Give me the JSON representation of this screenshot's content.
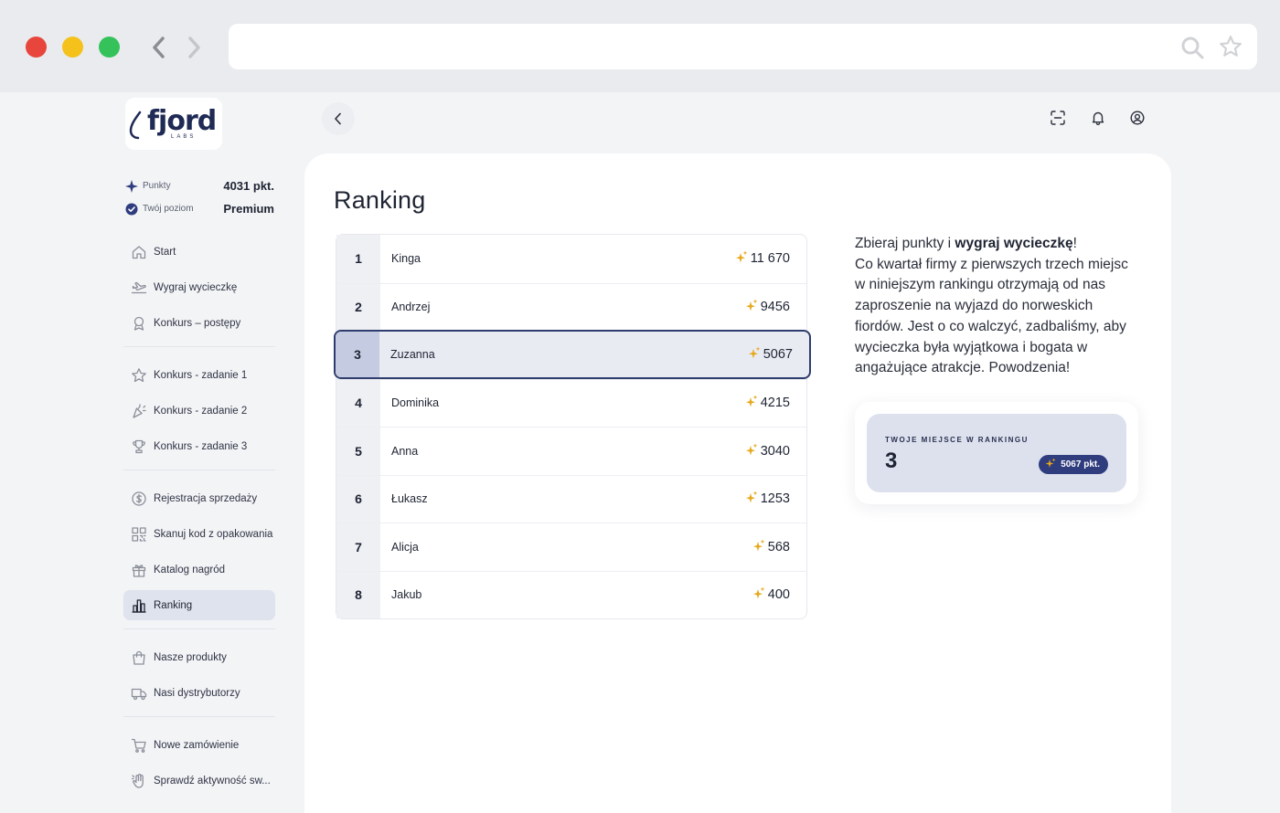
{
  "app": {
    "logo_text": "fjord",
    "logo_sub": "LABS"
  },
  "stats": {
    "points_label": "Punkty",
    "points_value": "4031 pkt.",
    "level_label": "Twój poziom",
    "level_value": "Premium"
  },
  "sidebar": {
    "groups": [
      [
        {
          "label": "Start",
          "icon": "home-icon"
        },
        {
          "label": "Wygraj wycieczkę",
          "icon": "plane-icon"
        },
        {
          "label": "Konkurs – postępy",
          "icon": "award-icon"
        }
      ],
      [
        {
          "label": "Konkurs - zadanie 1",
          "icon": "star-icon"
        },
        {
          "label": "Konkurs - zadanie 2",
          "icon": "party-icon"
        },
        {
          "label": "Konkurs - zadanie 3",
          "icon": "trophy-icon"
        }
      ],
      [
        {
          "label": "Rejestracja sprzedaży",
          "icon": "dollar-icon"
        },
        {
          "label": "Skanuj kod z opakowania",
          "icon": "qr-icon"
        },
        {
          "label": "Katalog nagród",
          "icon": "gift-icon"
        },
        {
          "label": "Ranking",
          "icon": "chart-icon",
          "active": true
        }
      ],
      [
        {
          "label": "Nasze produkty",
          "icon": "bag-icon"
        },
        {
          "label": "Nasi dystrybutorzy",
          "icon": "truck-icon"
        }
      ],
      [
        {
          "label": "Nowe zamówienie",
          "icon": "cart-icon"
        },
        {
          "label": "Sprawdź aktywność sw...",
          "icon": "hand-icon"
        }
      ]
    ]
  },
  "page": {
    "title": "Ranking"
  },
  "ranking": [
    {
      "place": "1",
      "name": "Kinga",
      "score": "11 670"
    },
    {
      "place": "2",
      "name": "Andrzej",
      "score": "9456"
    },
    {
      "place": "3",
      "name": "Zuzanna",
      "score": "5067",
      "highlight": true
    },
    {
      "place": "4",
      "name": "Dominika",
      "score": "4215"
    },
    {
      "place": "5",
      "name": "Anna",
      "score": "3040"
    },
    {
      "place": "6",
      "name": "Łukasz",
      "score": "1253"
    },
    {
      "place": "7",
      "name": "Alicja",
      "score": "568"
    },
    {
      "place": "8",
      "name": "Jakub",
      "score": "400"
    }
  ],
  "info": {
    "intro_plain": "Zbieraj punkty i ",
    "intro_bold": "wygraj wycieczkę",
    "intro_end": "!",
    "body": "Co kwartał firmy z pierwszych trzech miejsc w niniejszym rankingu otrzymają od nas zaproszenie na wyjazd do norweskich fiordów. Jest o co walczyć, zadbaliśmy, aby wycieczka była wyjątkowa i bogata w angażujące atrakcje. Powodzenia!"
  },
  "my_place": {
    "label": "TWOJE MIEJSCE W RANKINGU",
    "value": "3",
    "points": "5067 pkt."
  },
  "colors": {
    "accent": "#2f3d7e",
    "spark": "#e7a81b",
    "active_bg": "#dfe3ee"
  }
}
